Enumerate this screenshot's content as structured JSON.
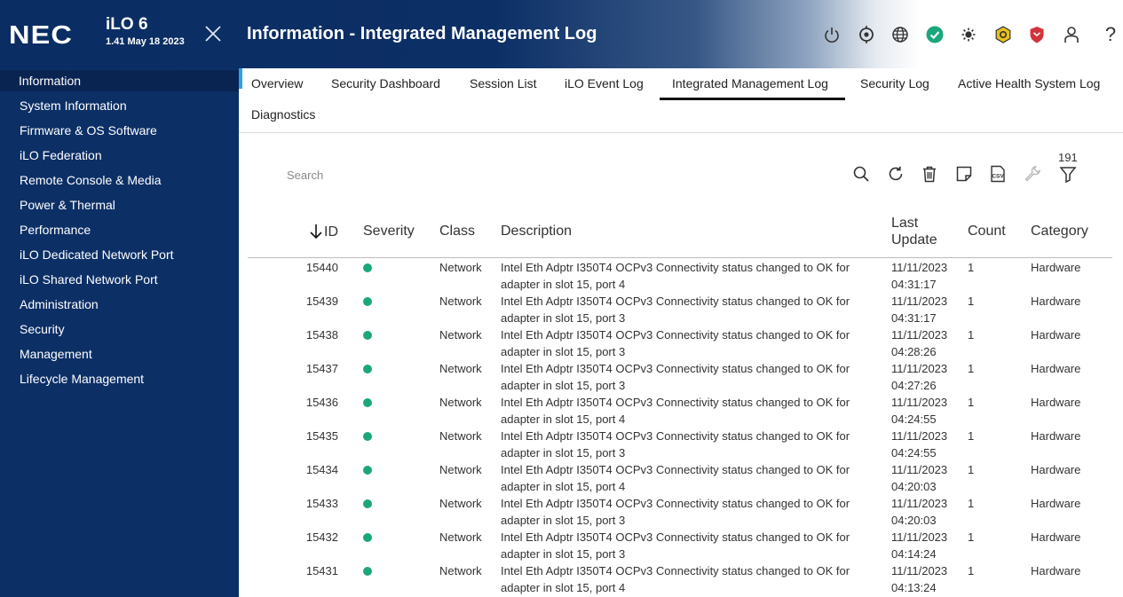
{
  "header": {
    "brand": "NEC",
    "product": "iLO 6",
    "version": "1.41 May 18 2023",
    "title": "Information - Integrated Management Log",
    "icons": [
      "power-icon",
      "location-icon",
      "globe-icon",
      "health-ok-icon",
      "brightness-icon",
      "security-badge-icon",
      "shield-alert-icon",
      "user-icon",
      "help-icon"
    ],
    "colors": {
      "header_bg": "#0c2f66",
      "health_ok": "#1aa77b",
      "badge_yellow": "#e8c11c",
      "shield_red": "#d3343c"
    }
  },
  "sidebar": {
    "items": [
      {
        "label": "Information",
        "active": true
      },
      {
        "label": "System Information"
      },
      {
        "label": "Firmware & OS Software"
      },
      {
        "label": "iLO Federation"
      },
      {
        "label": "Remote Console & Media"
      },
      {
        "label": "Power & Thermal"
      },
      {
        "label": "Performance"
      },
      {
        "label": "iLO Dedicated Network Port"
      },
      {
        "label": "iLO Shared Network Port"
      },
      {
        "label": "Administration"
      },
      {
        "label": "Security"
      },
      {
        "label": "Management"
      },
      {
        "label": "Lifecycle Management"
      }
    ]
  },
  "tabs": [
    {
      "label": "Overview"
    },
    {
      "label": "Security Dashboard"
    },
    {
      "label": "Session List"
    },
    {
      "label": "iLO Event Log"
    },
    {
      "label": "Integrated Management Log",
      "active": true
    },
    {
      "label": "Security Log"
    },
    {
      "label": "Active Health System Log"
    },
    {
      "label": "Diagnostics"
    }
  ],
  "toolbar": {
    "search_placeholder": "Search",
    "filter_count": "191",
    "tools": [
      "search-icon",
      "refresh-icon",
      "trash-icon",
      "note-icon",
      "csv-icon",
      "wrench-icon",
      "filter-icon"
    ]
  },
  "table": {
    "columns": {
      "id": "ID",
      "severity": "Severity",
      "class": "Class",
      "description": "Description",
      "last_update_1": "Last",
      "last_update_2": "Update",
      "count": "Count",
      "category": "Category"
    },
    "sort": "descending-by-id",
    "rows": [
      {
        "id": "15440",
        "severity": "ok",
        "class": "Network",
        "desc1": "Intel Eth Adptr I350T4 OCPv3 Connectivity status changed to OK for",
        "desc2": "adapter in slot 15, port 4",
        "date": "11/11/2023",
        "time": "04:31:17",
        "count": "1",
        "category": "Hardware"
      },
      {
        "id": "15439",
        "severity": "ok",
        "class": "Network",
        "desc1": "Intel Eth Adptr I350T4 OCPv3 Connectivity status changed to OK for",
        "desc2": "adapter in slot 15, port 3",
        "date": "11/11/2023",
        "time": "04:31:17",
        "count": "1",
        "category": "Hardware"
      },
      {
        "id": "15438",
        "severity": "ok",
        "class": "Network",
        "desc1": "Intel Eth Adptr I350T4 OCPv3 Connectivity status changed to OK for",
        "desc2": "adapter in slot 15, port 3",
        "date": "11/11/2023",
        "time": "04:28:26",
        "count": "1",
        "category": "Hardware"
      },
      {
        "id": "15437",
        "severity": "ok",
        "class": "Network",
        "desc1": "Intel Eth Adptr I350T4 OCPv3 Connectivity status changed to OK for",
        "desc2": "adapter in slot 15, port 3",
        "date": "11/11/2023",
        "time": "04:27:26",
        "count": "1",
        "category": "Hardware"
      },
      {
        "id": "15436",
        "severity": "ok",
        "class": "Network",
        "desc1": "Intel Eth Adptr I350T4 OCPv3 Connectivity status changed to OK for",
        "desc2": "adapter in slot 15, port 4",
        "date": "11/11/2023",
        "time": "04:24:55",
        "count": "1",
        "category": "Hardware"
      },
      {
        "id": "15435",
        "severity": "ok",
        "class": "Network",
        "desc1": "Intel Eth Adptr I350T4 OCPv3 Connectivity status changed to OK for",
        "desc2": "adapter in slot 15, port 3",
        "date": "11/11/2023",
        "time": "04:24:55",
        "count": "1",
        "category": "Hardware"
      },
      {
        "id": "15434",
        "severity": "ok",
        "class": "Network",
        "desc1": "Intel Eth Adptr I350T4 OCPv3 Connectivity status changed to OK for",
        "desc2": "adapter in slot 15, port 4",
        "date": "11/11/2023",
        "time": "04:20:03",
        "count": "1",
        "category": "Hardware"
      },
      {
        "id": "15433",
        "severity": "ok",
        "class": "Network",
        "desc1": "Intel Eth Adptr I350T4 OCPv3 Connectivity status changed to OK for",
        "desc2": "adapter in slot 15, port 3",
        "date": "11/11/2023",
        "time": "04:20:03",
        "count": "1",
        "category": "Hardware"
      },
      {
        "id": "15432",
        "severity": "ok",
        "class": "Network",
        "desc1": "Intel Eth Adptr I350T4 OCPv3 Connectivity status changed to OK for",
        "desc2": "adapter in slot 15, port 3",
        "date": "11/11/2023",
        "time": "04:14:24",
        "count": "1",
        "category": "Hardware"
      },
      {
        "id": "15431",
        "severity": "ok",
        "class": "Network",
        "desc1": "Intel Eth Adptr I350T4 OCPv3 Connectivity status changed to OK for",
        "desc2": "adapter in slot 15, port 4",
        "date": "11/11/2023",
        "time": "04:13:24",
        "count": "1",
        "category": "Hardware"
      }
    ]
  }
}
